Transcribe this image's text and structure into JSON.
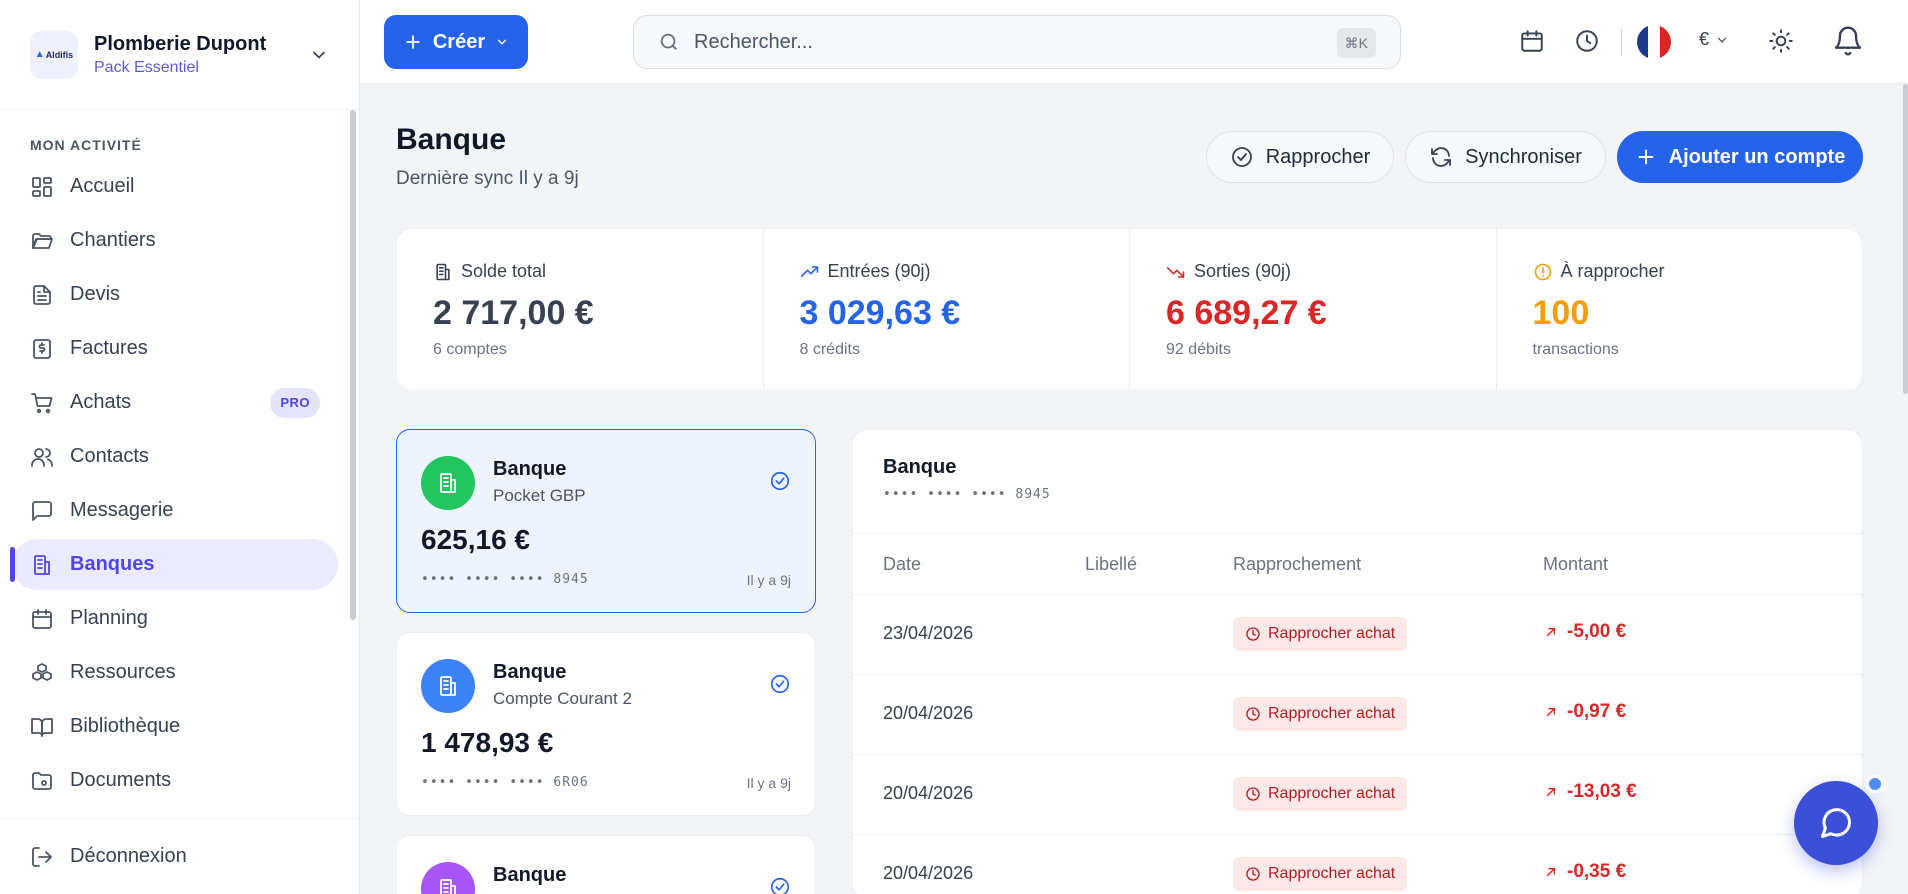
{
  "org": {
    "logo_text": "Aldifis",
    "name": "Plomberie Dupont",
    "plan": "Pack Essentiel"
  },
  "sidebar": {
    "section_title": "MON ACTIVITÉ",
    "items": [
      {
        "label": "Accueil",
        "icon": "dashboard-icon"
      },
      {
        "label": "Chantiers",
        "icon": "folder-open-icon"
      },
      {
        "label": "Devis",
        "icon": "file-text-icon"
      },
      {
        "label": "Factures",
        "icon": "receipt-icon"
      },
      {
        "label": "Achats",
        "icon": "cart-icon",
        "badge": "PRO"
      },
      {
        "label": "Contacts",
        "icon": "users-icon"
      },
      {
        "label": "Messagerie",
        "icon": "message-icon"
      },
      {
        "label": "Banques",
        "icon": "bank-icon",
        "active": true
      },
      {
        "label": "Planning",
        "icon": "calendar-icon"
      },
      {
        "label": "Ressources",
        "icon": "boxes-icon"
      },
      {
        "label": "Bibliothèque",
        "icon": "book-icon"
      },
      {
        "label": "Documents",
        "icon": "folder-icon"
      }
    ],
    "logout": "Déconnexion"
  },
  "topbar": {
    "create_label": "Créer",
    "search_placeholder": "Rechercher...",
    "search_shortcut": "⌘K",
    "currency": "€"
  },
  "page": {
    "title": "Banque",
    "subtitle": "Dernière sync Il y a 9j",
    "actions": {
      "reconcile": "Rapprocher",
      "sync": "Synchroniser",
      "add_account": "Ajouter un compte"
    }
  },
  "stats": [
    {
      "label": "Solde total",
      "value": "2 717,00 €",
      "caption": "6 comptes",
      "color": "#374151",
      "icon": "building-icon"
    },
    {
      "label": "Entrées (90j)",
      "value": "3 029,63 €",
      "caption": "8 crédits",
      "color": "#2563eb",
      "icon": "trending-up-icon"
    },
    {
      "label": "Sorties (90j)",
      "value": "6 689,27 €",
      "caption": "92 débits",
      "color": "#dc2626",
      "icon": "trending-down-icon"
    },
    {
      "label": "À rapprocher",
      "value": "100",
      "caption": "transactions",
      "color": "#f59e0b",
      "icon": "alert-circle-icon"
    }
  ],
  "accounts": [
    {
      "name": "Banque",
      "sub": "Pocket GBP",
      "balance": "625,16 €",
      "mask": "•••• •••• •••• 8945",
      "time": "Il y a 9j",
      "color": "#22c55e",
      "selected": true
    },
    {
      "name": "Banque",
      "sub": "Compte Courant 2",
      "balance": "1 478,93 €",
      "mask": "•••• •••• •••• 6R06",
      "time": "Il y a 9j",
      "color": "#3b82f6",
      "selected": false
    },
    {
      "name": "Banque",
      "color": "#a855f7",
      "selected": false
    }
  ],
  "transactions": {
    "title": "Banque",
    "mask": "•••• •••• •••• 8945",
    "columns": [
      "Date",
      "Libellé",
      "Rapprochement",
      "Montant"
    ],
    "rows": [
      {
        "date": "23/04/2026",
        "label": "",
        "status": "Rapprocher achat",
        "amount": "-5,00 €"
      },
      {
        "date": "20/04/2026",
        "label": "",
        "status": "Rapprocher achat",
        "amount": "-0,97 €"
      },
      {
        "date": "20/04/2026",
        "label": "",
        "status": "Rapprocher achat",
        "amount": "-13,03 €"
      },
      {
        "date": "20/04/2026",
        "label": "",
        "status": "Rapprocher achat",
        "amount": "-0,35 €"
      }
    ]
  }
}
